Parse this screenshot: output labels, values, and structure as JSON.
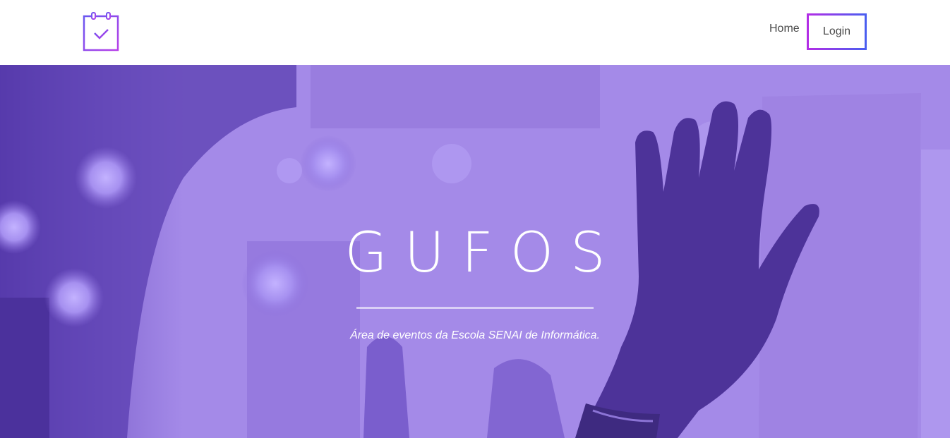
{
  "nav": {
    "home_label": "Home",
    "login_label": "Login"
  },
  "hero": {
    "title": "GUFOS",
    "subtitle": "Área de eventos da Escola SENAI de Informática."
  },
  "icons": {
    "logo": "calendar-check-icon"
  },
  "colors": {
    "accent_start": "#b32de6",
    "accent_end": "#4a5ef0",
    "hero_base": "#a288e6",
    "hero_dark": "#4f33a0"
  }
}
